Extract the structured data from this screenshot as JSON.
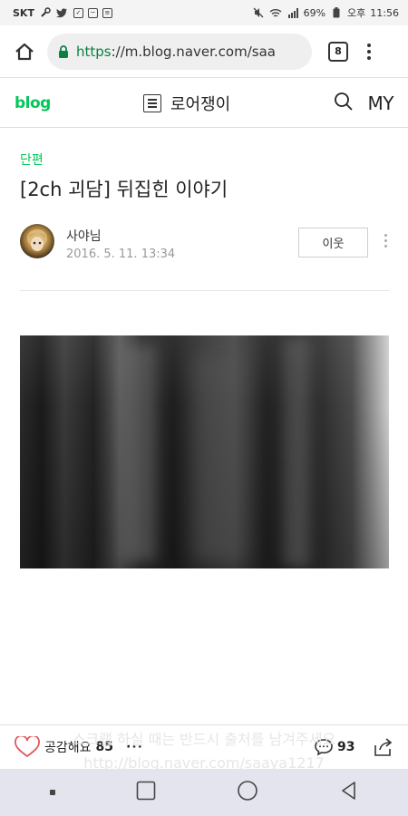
{
  "status_bar": {
    "carrier": "SKT",
    "battery": "69%",
    "ampm": "오후",
    "time": "11:56"
  },
  "browser": {
    "url_scheme": "https",
    "url_rest": "://m.blog.naver.com/saa",
    "tab_count": "8"
  },
  "blog_header": {
    "logo": "blog",
    "blog_name": "로어쟁이",
    "my_label": "MY"
  },
  "post": {
    "category": "단편",
    "title": "[2ch 괴담] 뒤집힌 이야기",
    "author": "사야님",
    "date": "2016. 5. 11. 13:34",
    "neighbor_button": "이웃"
  },
  "action_bar": {
    "like_label": "공감해요",
    "like_count": "85",
    "more_label": "···",
    "comment_count": "93",
    "watermark_line1": "스크랩 하실 때는 반드시 출처를 남겨주세요",
    "watermark_line2": "http://blog.naver.com/saaya1217"
  },
  "colors": {
    "brand_green": "#03c75a",
    "url_green": "#0b8043",
    "like_heart": "#e05a5a"
  }
}
